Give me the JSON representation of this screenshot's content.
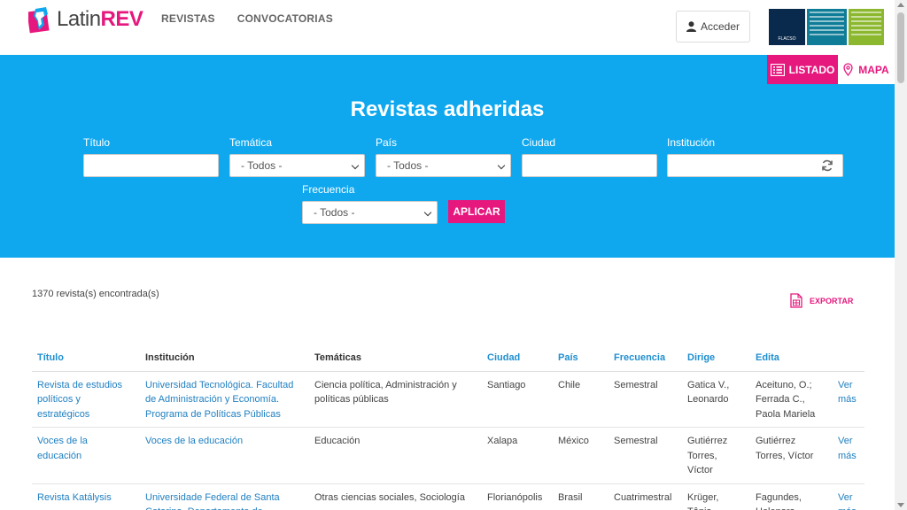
{
  "brand": {
    "logo_text_a": "Latin",
    "logo_text_b": "REV",
    "accent": "#e6177d",
    "hero_bg": "#0fa8ef"
  },
  "nav": {
    "items": [
      "REVISTAS",
      "CONVOCATORIAS"
    ]
  },
  "header": {
    "login_label": "Acceder",
    "login_icon": "user-icon",
    "partner_label": "FLACSO"
  },
  "view_toggle": {
    "list_label": "LISTADO",
    "map_label": "MAPA"
  },
  "hero": {
    "title": "Revistas adheridas"
  },
  "filters": {
    "titulo_label": "Título",
    "tematica_label": "Temática",
    "tematica_value": "- Todos -",
    "pais_label": "País",
    "pais_value": "- Todos -",
    "ciudad_label": "Ciudad",
    "institucion_label": "Institución",
    "frecuencia_label": "Frecuencia",
    "frecuencia_value": "- Todos -",
    "apply_label": "APLICAR"
  },
  "results": {
    "count_text": "1370 revista(s) encontrada(s)",
    "export_label": "EXPORTAR"
  },
  "table": {
    "headers": [
      "Título",
      "Institución",
      "Temáticas",
      "Ciudad",
      "País",
      "Frecuencia",
      "Dirige",
      "Edita",
      ""
    ],
    "rows": [
      [
        "Revista de estudios políticos y estratégicos",
        "Universidad Tecnológica. Facultad de Administración y Economía. Programa de Políticas Públicas",
        "Ciencia política, Administración y políticas públicas",
        "Santiago",
        "Chile",
        "Semestral",
        "Gatica V., Leonardo",
        "Aceituno, O.; Ferrada C., Paola Mariela",
        "Ver más"
      ],
      [
        "Voces de la educación",
        "Voces de la educación",
        "Educación",
        "Xalapa",
        "México",
        "Semestral",
        "Gutiérrez Torres, Víctor",
        "Gutiérrez Torres, Víctor",
        "Ver más"
      ],
      [
        "Revista Katálysis",
        "Universidade Federal de Santa Catarina. Departamento de",
        "Otras ciencias sociales, Sociología",
        "Florianópolis",
        "Brasil",
        "Cuatrimestral",
        "Krüger, Tânia",
        "Fagundes, Helenara",
        "Ver más"
      ]
    ]
  }
}
